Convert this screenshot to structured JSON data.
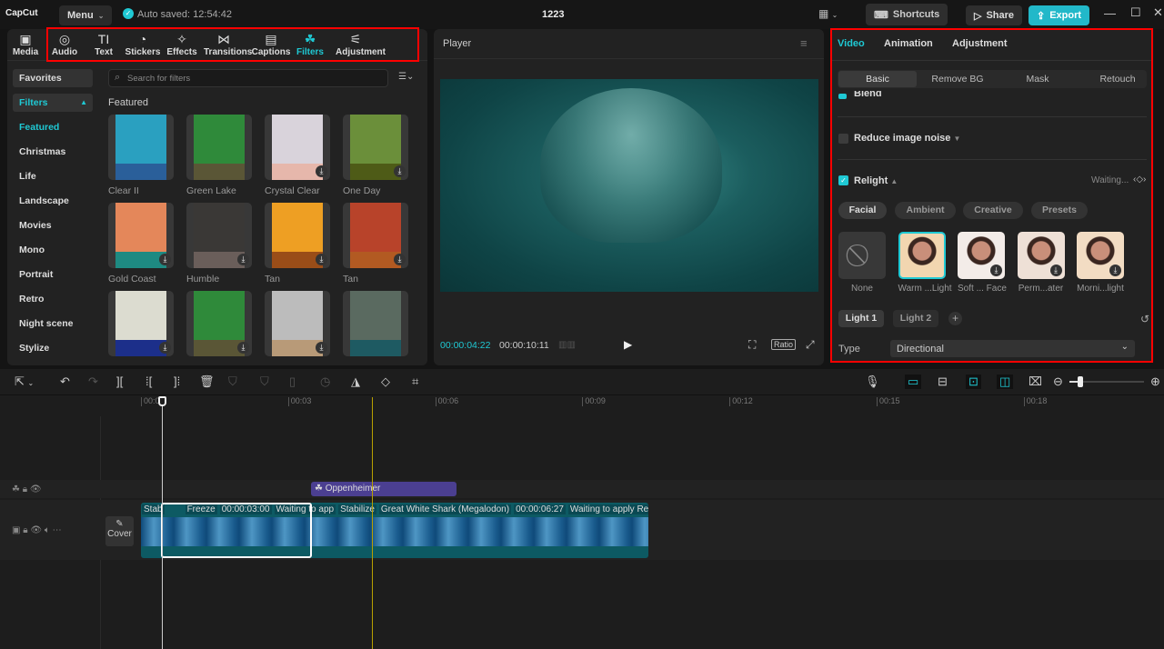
{
  "app": {
    "logo": "CapCut",
    "menu": "Menu",
    "autosave": "Auto saved: 12:54:42",
    "project_title": "1223",
    "shortcuts": "Shortcuts",
    "share": "Share",
    "export": "Export"
  },
  "colors": {
    "accent": "#1fc9d4",
    "export_bg": "#22b8c9",
    "highlight_border": "#ff0000",
    "filter_clip": "#4b3f91",
    "video_clip": "#0d5a63"
  },
  "tools": [
    {
      "label": "Media",
      "icon": "media-icon"
    },
    {
      "label": "Audio",
      "icon": "audio-icon"
    },
    {
      "label": "Text",
      "icon": "text-icon"
    },
    {
      "label": "Stickers",
      "icon": "sticker-icon"
    },
    {
      "label": "Effects",
      "icon": "effects-icon"
    },
    {
      "label": "Transitions",
      "icon": "transitions-icon"
    },
    {
      "label": "Captions",
      "icon": "captions-icon"
    },
    {
      "label": "Filters",
      "icon": "filters-icon",
      "active": true
    },
    {
      "label": "Adjustment",
      "icon": "adjustment-icon"
    }
  ],
  "categories": [
    "Favorites",
    "Filters",
    "Featured",
    "Christmas",
    "Life",
    "Landscape",
    "Movies",
    "Mono",
    "Portrait",
    "Retro",
    "Night scene",
    "Stylize"
  ],
  "search": {
    "placeholder": "Search for filters"
  },
  "section": "Featured",
  "filters": [
    {
      "label": "Clear II",
      "img": "#2aa0c0",
      "sw": "#2a5f9a",
      "dl": false
    },
    {
      "label": "Green Lake",
      "img": "#2f8a3a",
      "sw": "#5a5636",
      "dl": false
    },
    {
      "label": "Crystal Clear",
      "img": "#d9d3db",
      "sw": "#e6b7ab",
      "dl": true
    },
    {
      "label": "One Day",
      "img": "#6b8f3a",
      "sw": "#4e5b17",
      "dl": true
    },
    {
      "label": "Gold Coast",
      "img": "#e4875a",
      "sw": "#1e8a82",
      "dl": true
    },
    {
      "label": "Humble",
      "img": "#3a3836",
      "sw": "#6a5e5a",
      "dl": true
    },
    {
      "label": "Tan",
      "img": "#ee9f23",
      "sw": "#9a4d18",
      "dl": true
    },
    {
      "label": "Tan",
      "img": "#b8432a",
      "sw": "#b25a22",
      "dl": true
    },
    {
      "label": "",
      "img": "#dcdcd0",
      "sw": "#1c2f8a",
      "dl": true
    },
    {
      "label": "",
      "img": "#2f8a3a",
      "sw": "#5a5636",
      "dl": true
    },
    {
      "label": "",
      "img": "#bcbcbc",
      "sw": "#b89a78",
      "dl": true
    },
    {
      "label": "",
      "img": "#5a6a60",
      "sw": "#1e5a62",
      "dl": false
    }
  ],
  "player": {
    "title": "Player",
    "current": "00:00:04:22",
    "total": "00:00:10:11",
    "ratio": "Ratio"
  },
  "inspector": {
    "tabs": [
      "Video",
      "Animation",
      "Adjustment"
    ],
    "subtabs": [
      "Basic",
      "Remove BG",
      "Mask",
      "Retouch"
    ],
    "blend": "Blend",
    "noise": "Reduce image noise",
    "relight": "Relight",
    "relight_status": "Waiting...",
    "relight_tabs": [
      "Facial",
      "Ambient",
      "Creative",
      "Presets"
    ],
    "presets": [
      {
        "label": "None"
      },
      {
        "label": "Warm ...Light"
      },
      {
        "label": "Soft ... Face"
      },
      {
        "label": "Perm...ater"
      },
      {
        "label": "Morni...light"
      }
    ],
    "lights": [
      "Light 1",
      "Light 2"
    ],
    "type_label": "Type",
    "type_value": "Directional"
  },
  "timeline": {
    "ticks": [
      "00:00",
      "00:03",
      "00:06",
      "00:09",
      "00:12",
      "00:15",
      "00:18"
    ],
    "filter_clip": "Oppenheimer",
    "cover": "Cover",
    "clip_tags": [
      "Stab",
      "Freeze",
      "00:00:03:00",
      "Waiting to app",
      "Stabilize",
      "Great White Shark (Megalodon)",
      "00:00:06:27",
      "Waiting to apply Relight..."
    ]
  }
}
